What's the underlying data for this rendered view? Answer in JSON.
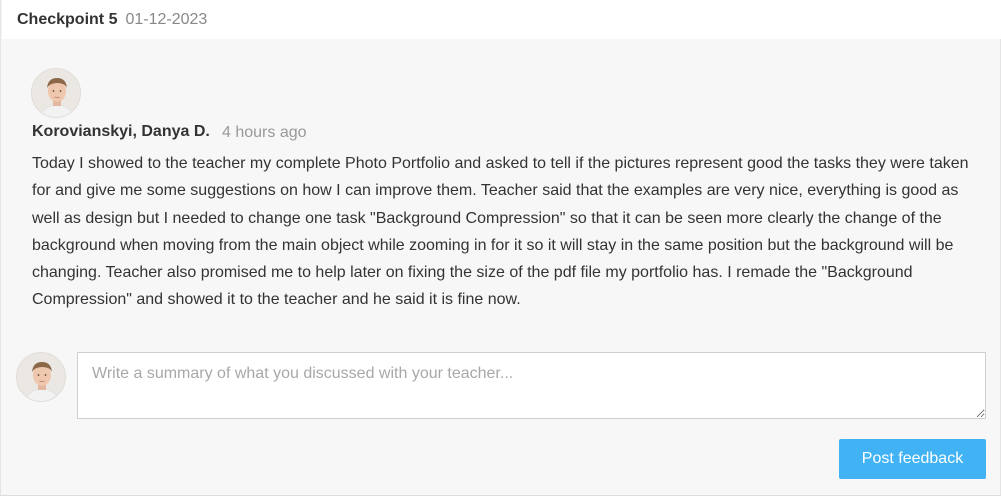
{
  "checkpoint": {
    "title": "Checkpoint 5",
    "date": "01-12-2023"
  },
  "comment": {
    "author": "Korovianskyi, Danya D.",
    "time": "4 hours ago",
    "text": "Today I showed to the teacher my complete Photo Portfolio and asked to tell if the pictures represent good the tasks they were taken for and give me some suggestions on how I can improve them. Teacher said that the examples are very nice, everything is good as well as design but I needed to change one task \"Background Compression\" so that it can be seen more clearly the change of the background when moving from the main object while zooming in for it so it will stay in the same position but the background will be changing. Teacher also promised me to help later on fixing the size of the pdf file my portfolio has. I remade the \"Background Compression\" and showed it to the teacher and he said it is fine now."
  },
  "feedback": {
    "placeholder": "Write a summary of what you discussed with your teacher...",
    "value": "",
    "button_label": "Post feedback"
  },
  "colors": {
    "button": "#41b3f4",
    "header_bg": "#ffffff",
    "panel_bg": "#f7f7f7",
    "muted_text": "#999999"
  },
  "icons": {
    "avatar": "user-avatar-photo",
    "resize": "resize-grip-icon"
  }
}
